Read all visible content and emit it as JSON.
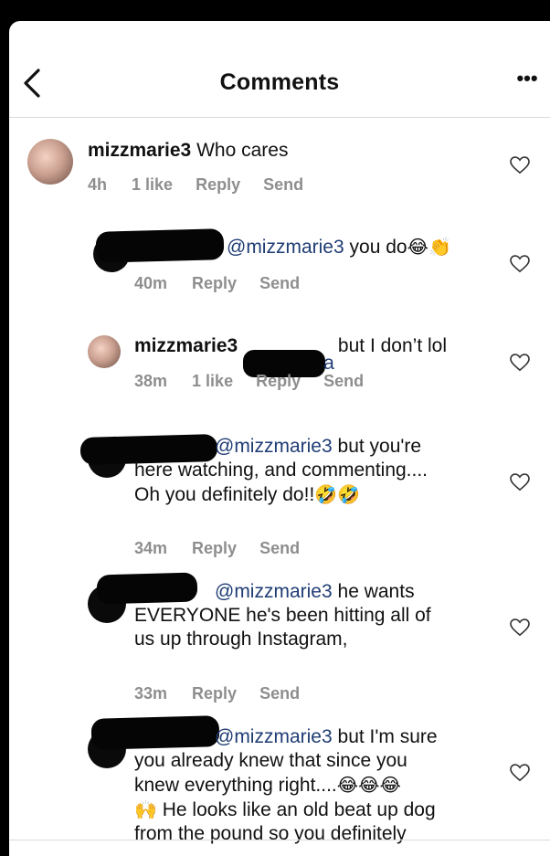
{
  "header": {
    "title": "Comments"
  },
  "comments": [
    {
      "username": "mizzmarie3",
      "text": "Who cares",
      "time": "4h",
      "likes": "1 like",
      "reply": "Reply",
      "send": "Send"
    },
    {
      "mention": "@mizzmarie3",
      "text": "you do",
      "emoji": "😂👏",
      "time": "40m",
      "reply": "Reply",
      "send": "Send"
    },
    {
      "username": "mizzmarie3",
      "mention_suffix": "a",
      "text": "but I don’t lol",
      "time": "38m",
      "likes": "1 like",
      "reply": "Reply",
      "send": "Send"
    },
    {
      "mention": "@mizzmarie3",
      "text_line1": "but you're",
      "text_line2": "here watching, and commenting....",
      "text_line3": "Oh you definitely do!!",
      "emoji": "🤣🤣",
      "time": "34m",
      "reply": "Reply",
      "send": "Send"
    },
    {
      "mention": "@mizzmarie3",
      "text_line1": "he wants",
      "text_line2": "EVERYONE he's been hitting all of",
      "text_line3": "us up through Instagram,",
      "time": "33m",
      "reply": "Reply",
      "send": "Send"
    },
    {
      "mention": "@mizzmarie3",
      "text_line1": "but I'm sure",
      "text_line2": "you already knew that since you",
      "text_line3": "knew everything right....",
      "emoji_line3": "😂😂😂",
      "emoji_line4": "🙌",
      "text_line4": "He looks like an old beat up dog",
      "text_line5": "from the pound so you definitely"
    }
  ]
}
